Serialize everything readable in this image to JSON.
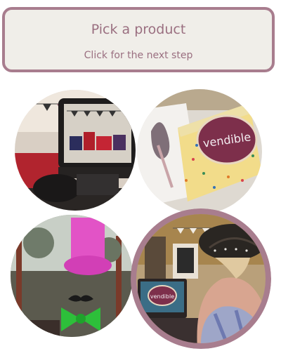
{
  "banner": {
    "title": "Pick a product",
    "subtitle": "Click for the next step"
  },
  "products": [
    {
      "id": "camera-setup",
      "icon": "camera-photo"
    },
    {
      "id": "vendible-box",
      "icon": "gift-box-photo",
      "logo_text": "vendible"
    },
    {
      "id": "photo-props",
      "icon": "photo-props-photo"
    },
    {
      "id": "event-booth",
      "icon": "event-photo",
      "logo_text": "vendible",
      "selected": true
    }
  ],
  "colors": {
    "accent": "#a87d8e",
    "banner_bg": "#f0eee9",
    "text": "#9a6f80"
  }
}
